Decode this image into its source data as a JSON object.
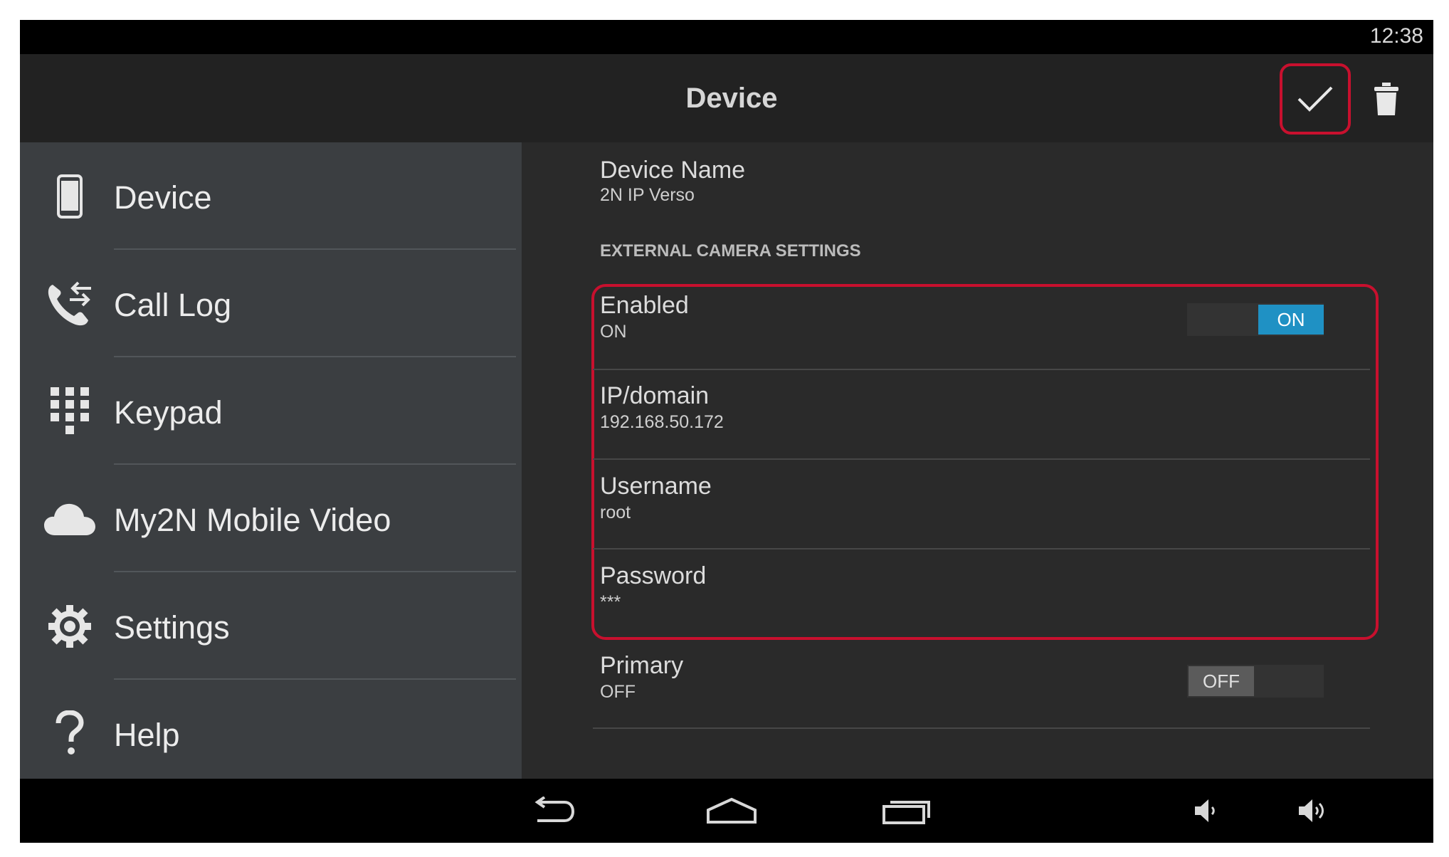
{
  "status_bar": {
    "time": "12:38"
  },
  "action_bar": {
    "title": "Device"
  },
  "sidebar": {
    "items": [
      {
        "label": "Device",
        "icon": "phone-icon"
      },
      {
        "label": "Call Log",
        "icon": "call-log-icon"
      },
      {
        "label": "Keypad",
        "icon": "keypad-icon"
      },
      {
        "label": "My2N Mobile Video",
        "icon": "cloud-icon"
      },
      {
        "label": "Settings",
        "icon": "gear-icon"
      },
      {
        "label": "Help",
        "icon": "help-icon"
      }
    ]
  },
  "content": {
    "device_name": {
      "title": "Device Name",
      "value": "2N IP Verso"
    },
    "section_header": "EXTERNAL CAMERA SETTINGS",
    "enabled": {
      "title": "Enabled",
      "value": "ON",
      "toggle": "ON"
    },
    "ip_domain": {
      "title": "IP/domain",
      "value": "192.168.50.172"
    },
    "username": {
      "title": "Username",
      "value": "root"
    },
    "password": {
      "title": "Password",
      "value": "***"
    },
    "primary": {
      "title": "Primary",
      "value": "OFF",
      "toggle": "OFF"
    }
  },
  "colors": {
    "accent": "#1f91c4",
    "highlight": "#c8102e",
    "sidebar": "#3b3e41",
    "content": "#2a2a2a"
  }
}
